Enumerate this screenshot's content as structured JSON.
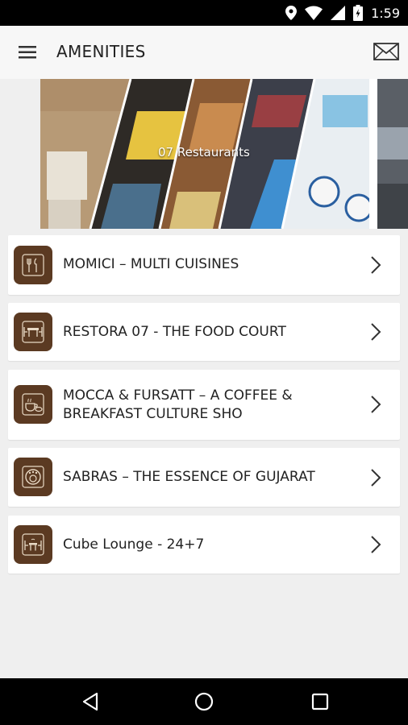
{
  "status_bar": {
    "time": "1:59"
  },
  "app_bar": {
    "title": "AMENITIES"
  },
  "banner": {
    "caption": "07 Restaurants"
  },
  "restaurants": [
    {
      "label": "MOMICI – MULTI CUISINES",
      "icon": "cutlery-icon"
    },
    {
      "label": "RESTORA 07 - THE FOOD COURT",
      "icon": "dining-table-icon"
    },
    {
      "label": "MOCCA & FURSATT – A COFFEE & BREAKFAST CULTURE SHO",
      "icon": "coffee-breakfast-icon"
    },
    {
      "label": "SABRAS – THE ESSENCE OF GUJARAT",
      "icon": "thali-icon"
    },
    {
      "label": "Cube Lounge - 24+7",
      "icon": "lounge-icon"
    }
  ],
  "colors": {
    "icon_tile": "#5b3a22",
    "background": "#efefef",
    "app_bar": "#f7f7f7"
  }
}
